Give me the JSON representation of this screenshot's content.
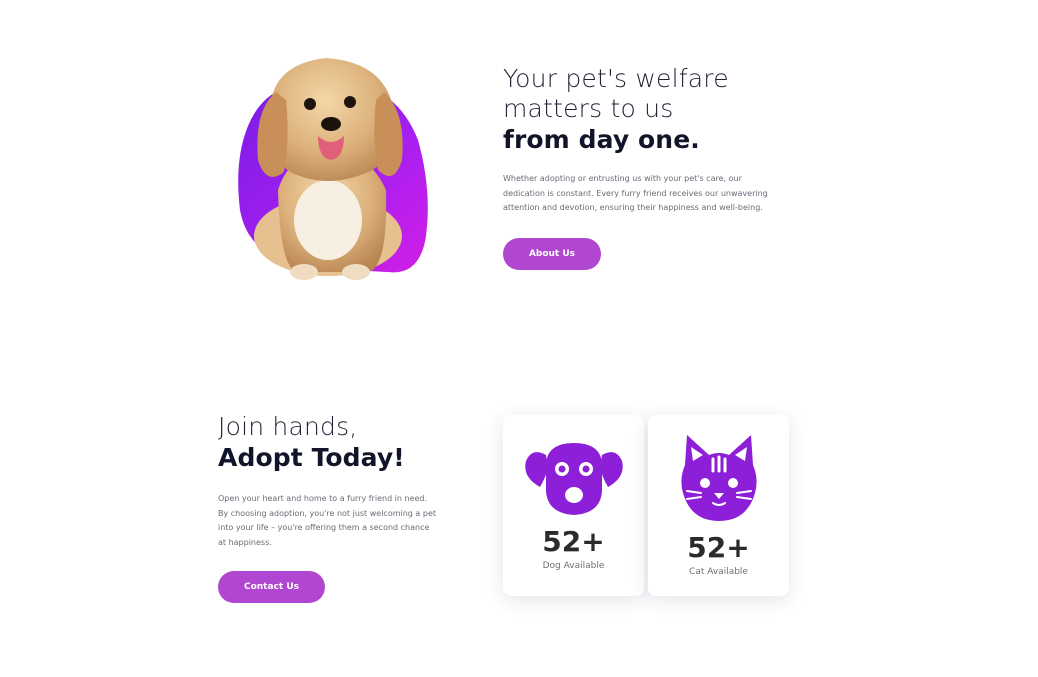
{
  "hero": {
    "heading_line1": "Your pet's welfare",
    "heading_line2": "matters to us",
    "heading_bold": "from day one.",
    "description": "Whether adopting or entrusting us with your pet's care, our dedication is constant. Every furry friend receives our unwavering attention and devotion, ensuring their happiness and well-being.",
    "button_label": "About Us",
    "image": "puppy-photo"
  },
  "adopt": {
    "heading_light": "Join hands,",
    "heading_bold": "Adopt Today!",
    "description": "Open your heart and home to a furry friend in need. By choosing adoption, you're not just welcoming a pet into your life – you're offering them a second chance at happiness.",
    "button_label": "Contact Us"
  },
  "stats": [
    {
      "icon": "dog-icon",
      "number": "52+",
      "label": "Dog Available"
    },
    {
      "icon": "cat-icon",
      "number": "52+",
      "label": "Cat Available"
    }
  ],
  "colors": {
    "accent": "#b146d0",
    "icon_purple": "#8e1fd8",
    "heading": "#12142a",
    "text": "#6b6b78"
  }
}
